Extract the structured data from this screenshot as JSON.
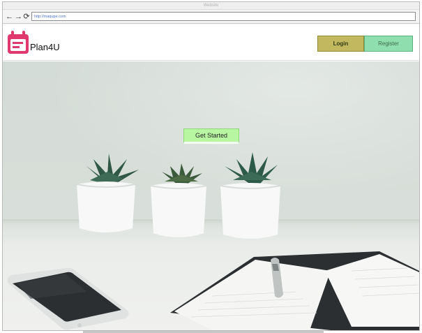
{
  "browser": {
    "title": "Website",
    "url": "http://maqupe.com",
    "nav": {
      "back_icon": "back-arrow-icon",
      "forward_icon": "forward-arrow-icon",
      "reload_icon": "reload-icon"
    }
  },
  "header": {
    "brand": "Plan4U",
    "logo_icon": "calendar-icon",
    "login_label": "Login",
    "register_label": "Register"
  },
  "hero": {
    "cta_label": "Get Started",
    "image_description_icon": "desk-plants-photo"
  },
  "colors": {
    "logo": "#e0396e",
    "login_bg": "#c2b860",
    "register_bg": "#8fdfae",
    "cta_bg": "#b8f6a1"
  }
}
